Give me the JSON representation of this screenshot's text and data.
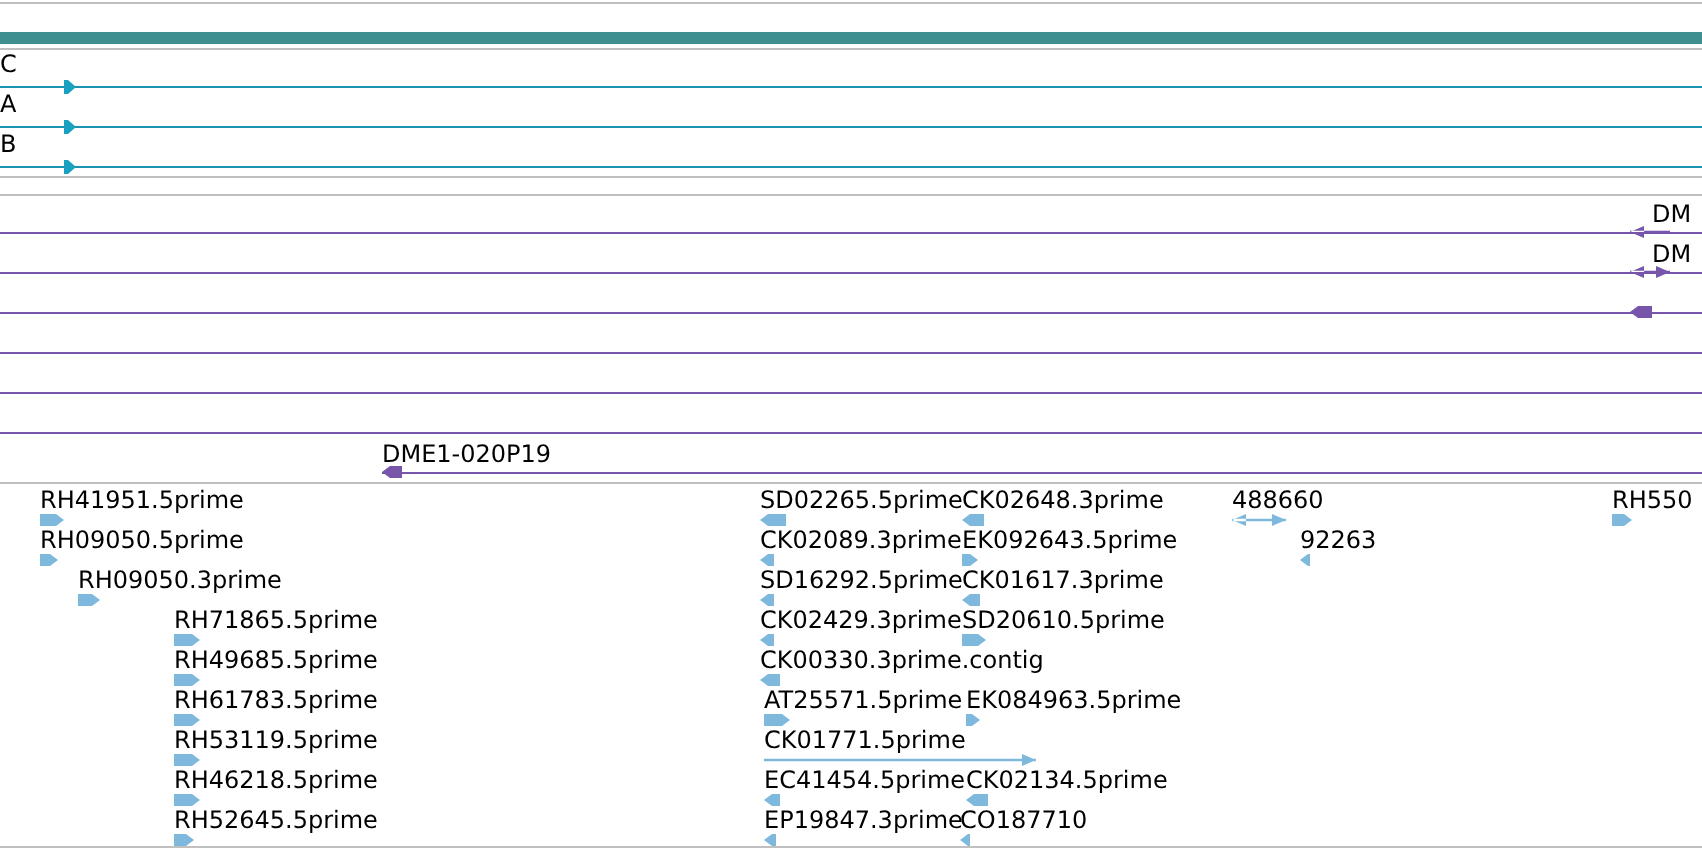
{
  "contig_track": [
    {
      "label": "C",
      "kind": "right"
    },
    {
      "label": "A",
      "kind": "right"
    },
    {
      "label": "B",
      "kind": "right"
    }
  ],
  "clone_track": [
    {
      "label": "DM",
      "kind": "left"
    },
    {
      "label": "DM",
      "kind": "both"
    },
    {
      "kind": "left"
    },
    {
      "label": "DME1-020P19",
      "kind": "left"
    }
  ],
  "est_track": [
    {
      "label": "RH41951.5prime",
      "kind": "right"
    },
    {
      "label": "RH09050.5prime",
      "kind": "right"
    },
    {
      "label": "RH09050.3prime",
      "kind": "right"
    },
    {
      "label": "RH71865.5prime",
      "kind": "right"
    },
    {
      "label": "RH49685.5prime",
      "kind": "right"
    },
    {
      "label": "RH61783.5prime",
      "kind": "right"
    },
    {
      "label": "RH53119.5prime",
      "kind": "right"
    },
    {
      "label": "RH46218.5prime",
      "kind": "right"
    },
    {
      "label": "RH52645.5prime",
      "kind": "right"
    },
    {
      "label": "SD02265.5prime",
      "kind": "left"
    },
    {
      "label": "CK02089.3prime",
      "kind": "left"
    },
    {
      "label": "SD16292.5prime",
      "kind": "left"
    },
    {
      "label": "CK02429.3prime",
      "kind": "left"
    },
    {
      "label": "CK00330.3prime.contig",
      "kind": "left"
    },
    {
      "label": "AT25571.5prime",
      "kind": "right"
    },
    {
      "label": "CK01771.5prime",
      "kind": "right"
    },
    {
      "label": "EC41454.5prime",
      "kind": "left"
    },
    {
      "label": "EP19847.3prime",
      "kind": "left"
    },
    {
      "label": "CK02648.3prime",
      "kind": "left"
    },
    {
      "label": "EK092643.5prime",
      "kind": "right"
    },
    {
      "label": "CK01617.3prime",
      "kind": "left"
    },
    {
      "label": "SD20610.5prime",
      "kind": "right"
    },
    {
      "label": "EK084963.5prime",
      "kind": "right"
    },
    {
      "label": "CK02134.5prime",
      "kind": "left"
    },
    {
      "label": "CO187710",
      "kind": "left"
    },
    {
      "label": "488660",
      "kind": "both"
    },
    {
      "label": "92263",
      "kind": "left"
    },
    {
      "label": "RH550",
      "kind": "right"
    }
  ]
}
